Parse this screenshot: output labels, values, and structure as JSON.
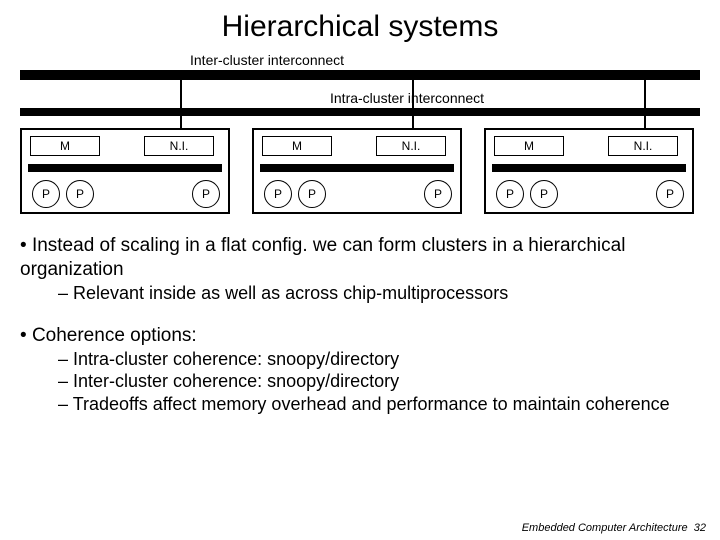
{
  "title": "Hierarchical systems",
  "diagram": {
    "inter_label": "Inter-cluster interconnect",
    "intra_label": "Intra-cluster interconnect",
    "module_mem_label": "M",
    "module_ni_label": "N.I.",
    "proc_label": "P"
  },
  "bullets": {
    "b1": "Instead of scaling in a flat config. we can form clusters in a hierarchical organization",
    "b1a": "Relevant inside as well as across chip-multiprocessors",
    "b2": "Coherence options:",
    "b2a": "Intra-cluster coherence: snoopy/directory",
    "b2b": "Inter-cluster coherence: snoopy/directory",
    "b2c": "Tradeoffs affect memory overhead and performance to maintain coherence"
  },
  "footer": {
    "course": "Embedded Computer Architecture",
    "page": "32"
  }
}
